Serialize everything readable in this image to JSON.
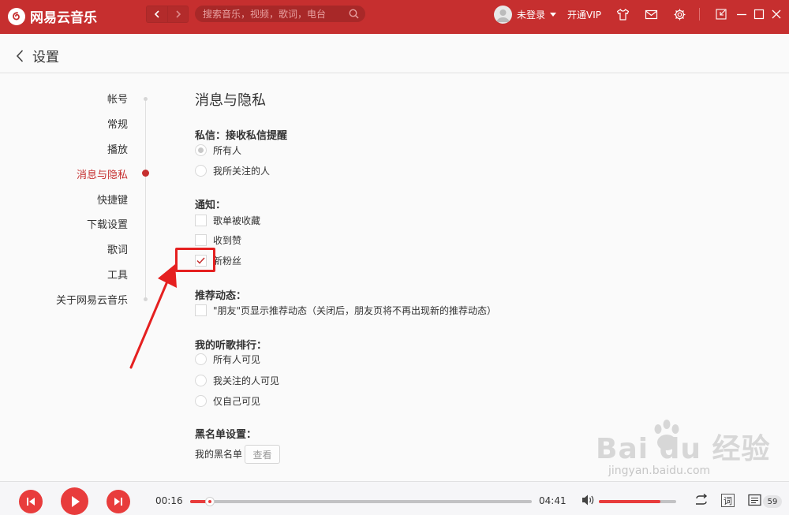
{
  "app": {
    "name": "网易云音乐",
    "search_placeholder": "搜索音乐，视频，歌词，电台",
    "user_label": "未登录",
    "vip_label": "开通VIP",
    "brand_color": "#c62f2f"
  },
  "header": {
    "title": "设置"
  },
  "nav": {
    "items": [
      {
        "label": "帐号",
        "active": false
      },
      {
        "label": "常规",
        "active": false
      },
      {
        "label": "播放",
        "active": false
      },
      {
        "label": "消息与隐私",
        "active": true
      },
      {
        "label": "快捷键",
        "active": false
      },
      {
        "label": "下载设置",
        "active": false
      },
      {
        "label": "歌词",
        "active": false
      },
      {
        "label": "工具",
        "active": false
      },
      {
        "label": "关于网易云音乐",
        "active": false
      }
    ]
  },
  "content": {
    "section_title": "消息与隐私",
    "private_msg": {
      "label": "私信：接收私信提醒",
      "options": [
        {
          "label": "所有人",
          "selected": true
        },
        {
          "label": "我所关注的人",
          "selected": false
        }
      ]
    },
    "notify": {
      "label": "通知：",
      "options": [
        {
          "label": "歌单被收藏",
          "checked": false
        },
        {
          "label": "收到赞",
          "checked": false
        },
        {
          "label": "新粉丝",
          "checked": true
        }
      ]
    },
    "recommend": {
      "label": "推荐动态：",
      "option": {
        "label": "\"朋友\"页显示推荐动态（关闭后，朋友页将不再出现新的推荐动态）",
        "checked": false
      }
    },
    "ranking": {
      "label": "我的听歌排行：",
      "options": [
        {
          "label": "所有人可见",
          "selected": false
        },
        {
          "label": "我关注的人可见",
          "selected": false
        },
        {
          "label": "仅自己可见",
          "selected": false
        }
      ]
    },
    "blacklist": {
      "label": "黑名单设置：",
      "item_label": "我的黑名单",
      "button_label": "查看"
    }
  },
  "player": {
    "elapsed": "00:16",
    "total": "04:41",
    "progress": 0.058,
    "volume": 0.8,
    "lyric_label": "词",
    "playlist_count": "59"
  },
  "watermark": {
    "main": "Bai du 经验",
    "sub": "jingyan.baidu.com"
  }
}
